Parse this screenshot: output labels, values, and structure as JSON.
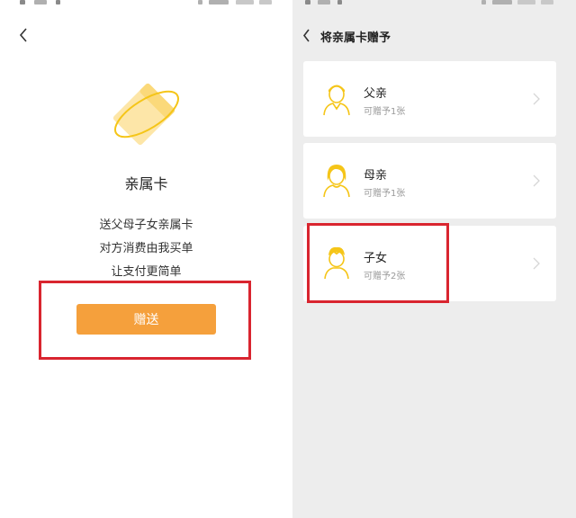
{
  "left_screen": {
    "card_title": "亲属卡",
    "description_lines": [
      "送父母子女亲属卡",
      "对方消费由我买单",
      "让支付更简单"
    ],
    "gift_button_label": "赠送"
  },
  "right_screen": {
    "title": "将亲属卡赠予",
    "recipients": [
      {
        "name": "父亲",
        "quota": "可赠予1张",
        "icon": "father-avatar-icon"
      },
      {
        "name": "母亲",
        "quota": "可赠予1张",
        "icon": "mother-avatar-icon"
      },
      {
        "name": "子女",
        "quota": "可赠予2张",
        "icon": "child-avatar-icon"
      }
    ]
  },
  "colors": {
    "accent_orange": "#f5a03c",
    "icon_yellow": "#f5c518",
    "annotation_red": "#d9252f",
    "right_background": "#ededed"
  }
}
